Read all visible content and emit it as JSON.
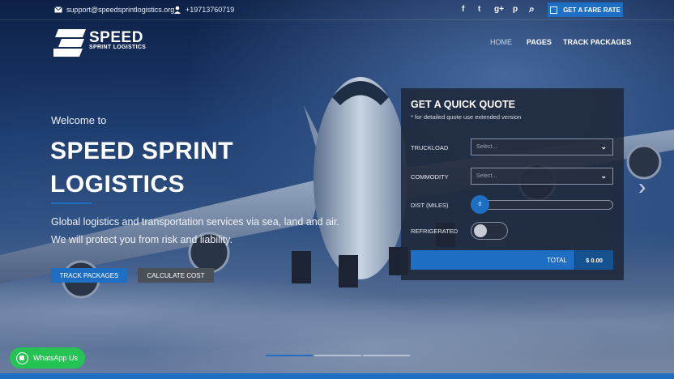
{
  "topbar": {
    "email": "support@speedsprintlogistics.org",
    "phone": "+19713760719",
    "social": [
      {
        "icon": "facebook-icon",
        "glyph": "f"
      },
      {
        "icon": "twitter-icon",
        "glyph": "t"
      },
      {
        "icon": "google-plus-icon",
        "glyph": "g+"
      },
      {
        "icon": "pinterest-icon",
        "glyph": "p"
      },
      {
        "icon": "search-icon",
        "glyph": "⌕"
      }
    ],
    "fare_button": "GET A FARE RATE"
  },
  "header": {
    "logo_main": "SPEED",
    "logo_sub": "SPRINT LOGISTICS",
    "nav": [
      "HOME",
      "PAGES",
      "TRACK PACKAGES"
    ]
  },
  "hero": {
    "welcome": "Welcome to",
    "title_line1": "SPEED SPRINT",
    "title_line2": "LOGISTICS",
    "description": "Global logistics and transportation services via sea, land and air. We will protect you from risk and liability.",
    "btn_track": "TRACK PACKAGES",
    "btn_calc": "CALCULATE COST"
  },
  "quote": {
    "title": "GET A QUICK QUOTE",
    "subtitle": "* for detailed quote use extended version",
    "truckload_label": "TRUCKLOAD",
    "truckload_value": "Select...",
    "commodity_label": "COMMODITY",
    "commodity_value": "Select...",
    "distance_label": "DIST (MILES)",
    "distance_value": "0",
    "refrigerated_label": "REFRIGERATED",
    "total_label": "TOTAL",
    "total_value": "$ 0.00"
  },
  "whatsapp": {
    "label": "WhatsApp Us"
  },
  "colors": {
    "accent": "#1e6fc4",
    "whatsapp": "#25c353",
    "panel": "#1e2637"
  }
}
